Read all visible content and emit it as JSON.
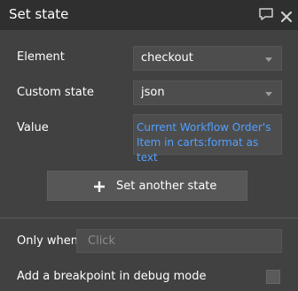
{
  "header": {
    "title": "Set state",
    "comment_icon": "speech-bubble-icon",
    "close_icon": "close-icon"
  },
  "element": {
    "label": "Element",
    "value": "checkout"
  },
  "custom_state": {
    "label": "Custom state",
    "value": "json"
  },
  "value": {
    "label": "Value",
    "line1": "Current Workflow Order's",
    "line2": "Item in carts:format as text"
  },
  "actions": {
    "set_another_label": "Set another state",
    "plus_icon": "plus-icon"
  },
  "only_when": {
    "label": "Only when",
    "placeholder": "Click"
  },
  "breakpoint": {
    "label": "Add a breakpoint in debug mode",
    "checked": false
  },
  "colors": {
    "header_bg": "#2f2f2f",
    "panel_bg": "#414141",
    "link_blue": "#52a0ff"
  }
}
